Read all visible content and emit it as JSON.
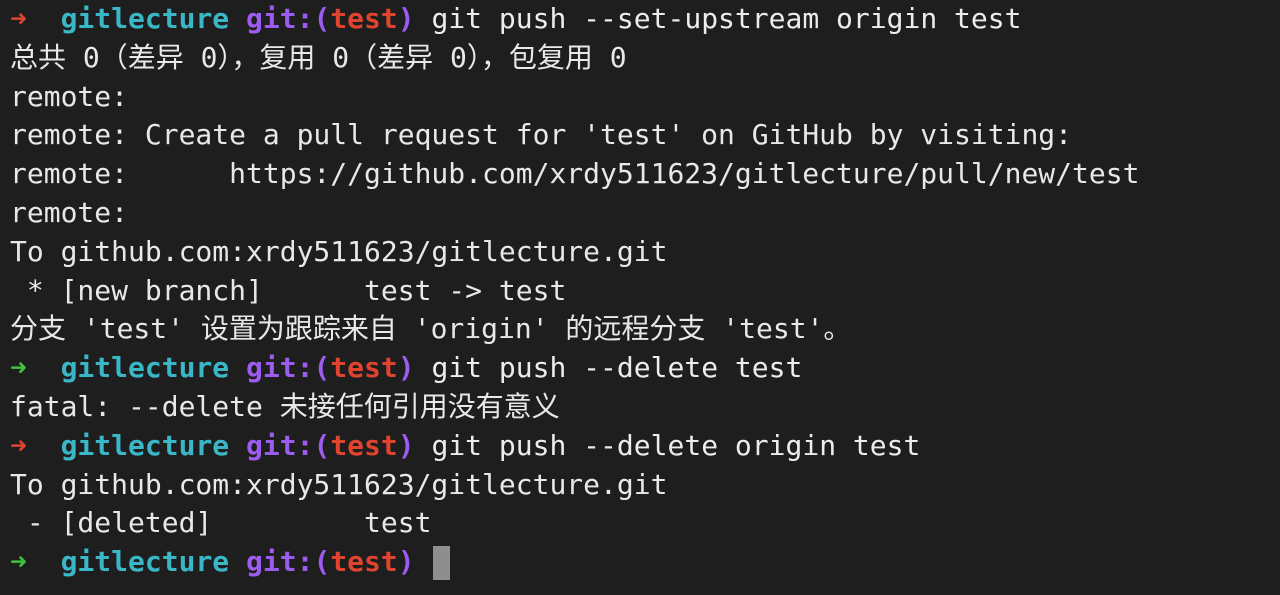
{
  "prompt": {
    "arrow": "➜",
    "dir": "gitlecture",
    "git_prefix": "git:(",
    "branch": "test",
    "git_suffix": ")"
  },
  "lines": [
    {
      "type": "prompt",
      "status": "error",
      "command": "git push --set-upstream origin test"
    },
    {
      "type": "output",
      "text": "总共 0（差异 0），复用 0（差异 0），包复用 0"
    },
    {
      "type": "output",
      "text": "remote:"
    },
    {
      "type": "output",
      "text": "remote: Create a pull request for 'test' on GitHub by visiting:"
    },
    {
      "type": "output",
      "text": "remote:      https://github.com/xrdy511623/gitlecture/pull/new/test"
    },
    {
      "type": "output",
      "text": "remote:"
    },
    {
      "type": "output",
      "text": "To github.com:xrdy511623/gitlecture.git"
    },
    {
      "type": "output",
      "text": " * [new branch]      test -> test"
    },
    {
      "type": "output",
      "text": "分支 'test' 设置为跟踪来自 'origin' 的远程分支 'test'。"
    },
    {
      "type": "prompt",
      "status": "ok",
      "command": "git push --delete test"
    },
    {
      "type": "output",
      "text": "fatal: --delete 未接任何引用没有意义"
    },
    {
      "type": "prompt",
      "status": "error",
      "command": "git push --delete origin test"
    },
    {
      "type": "output",
      "text": "To github.com:xrdy511623/gitlecture.git"
    },
    {
      "type": "output",
      "text": " - [deleted]         test"
    },
    {
      "type": "prompt",
      "status": "ok",
      "command": "",
      "cursor": true
    }
  ],
  "colors": {
    "background": "#1e1e1e",
    "arrow_error": "#e0432e",
    "arrow_ok": "#3ec13e",
    "dir": "#3ab7c7",
    "git_label": "#9d5cf0",
    "branch": "#e0432e",
    "cursor": "#8e8e8e"
  }
}
